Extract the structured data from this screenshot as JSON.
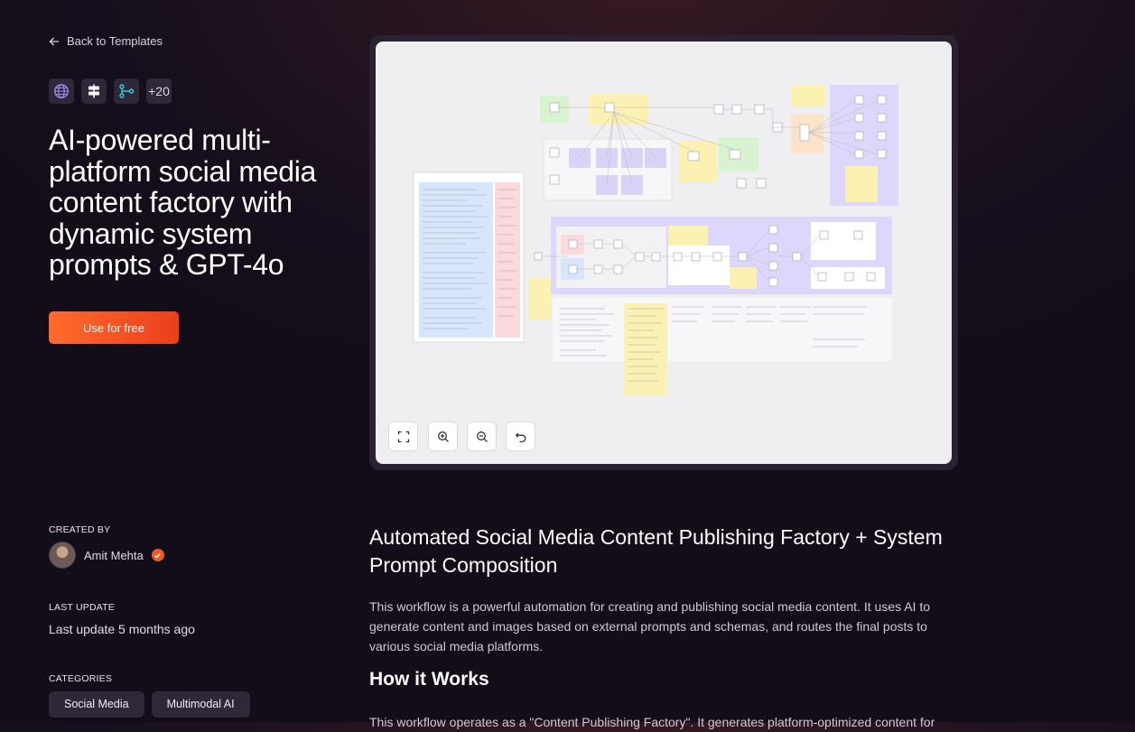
{
  "nav": {
    "back_label": "Back to Templates"
  },
  "integrations": {
    "icons": [
      "globe-icon",
      "signpost-icon",
      "workflow-icon"
    ],
    "more_count": "+20"
  },
  "template": {
    "title": "AI-powered multi-platform social media content factory with dynamic system prompts & GPT-4o",
    "cta_label": "Use for free"
  },
  "meta": {
    "created_by_label": "CREATED BY",
    "author_name": "Amit Mehta",
    "last_update_label": "LAST UPDATE",
    "last_update_value": "Last update 5 months ago",
    "categories_label": "CATEGORIES",
    "categories": [
      "Social Media",
      "Multimodal AI"
    ]
  },
  "content": {
    "heading": "Automated Social Media Content Publishing Factory + System Prompt Composition",
    "description": "This workflow is a powerful automation for creating and publishing social media content. It uses AI to generate content and images based on external prompts and schemas, and routes the final posts to various social media platforms.",
    "how_heading": "How it Works",
    "how_text_partial": "This workflow operates as a \"Content Publishing Factory\". It generates platform-optimized content for"
  },
  "colors": {
    "accent_start": "#ff6b2c",
    "accent_end": "#ea3f1c",
    "chip_bg": "#2f2838",
    "verified": "#ee5a2a"
  }
}
